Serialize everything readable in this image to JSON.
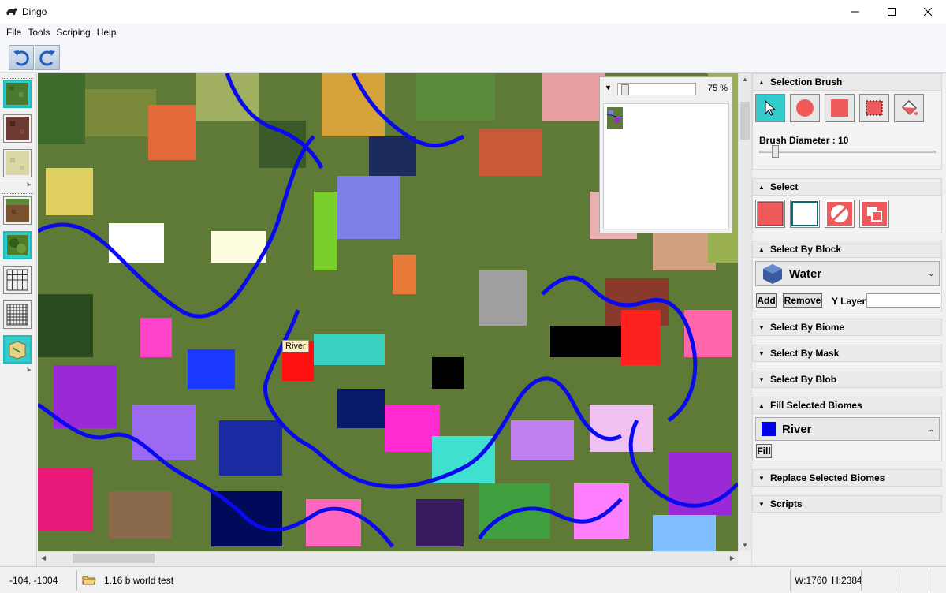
{
  "window": {
    "title": "Dingo"
  },
  "menu": {
    "items": [
      "File",
      "Tools",
      "Scriping",
      "Help"
    ]
  },
  "toolbar": {
    "undo_icon": "undo-icon",
    "redo_icon": "redo-icon"
  },
  "map": {
    "tooltip": "River"
  },
  "minimap": {
    "zoom_percent": "75 %"
  },
  "panel": {
    "selection_brush": {
      "title": "Selection Brush",
      "brush_diameter_label": "Brush Diameter : 10",
      "tools": [
        "pointer-icon",
        "circle-brush-icon",
        "square-brush-icon",
        "marquee-icon",
        "fill-bucket-icon"
      ]
    },
    "select": {
      "title": "Select",
      "tools": [
        "select-all-icon",
        "select-none-icon",
        "invert-selection-icon",
        "select-border-icon"
      ]
    },
    "select_by_block": {
      "title": "Select By Block",
      "block_value": "Water",
      "add_label": "Add",
      "remove_label": "Remove",
      "ylayer_label": "Y Layer",
      "ylayer_value": ""
    },
    "select_by_biome": {
      "title": "Select By Biome"
    },
    "select_by_mask": {
      "title": "Select By Mask"
    },
    "select_by_blob": {
      "title": "Select By Blob"
    },
    "fill_selected_biomes": {
      "title": "Fill Selected Biomes",
      "biome_value": "River",
      "biome_color": "#0000ee",
      "fill_label": "Fill"
    },
    "replace_selected_biomes": {
      "title": "Replace Selected Biomes"
    },
    "scripts": {
      "title": "Scripts"
    }
  },
  "status": {
    "coords": "-104, -1004",
    "world_name": "1.16 b world test",
    "width": "W:1760",
    "height": "H:2384"
  },
  "colors": {
    "accent": "#33cccc",
    "river": "#0000ee"
  }
}
